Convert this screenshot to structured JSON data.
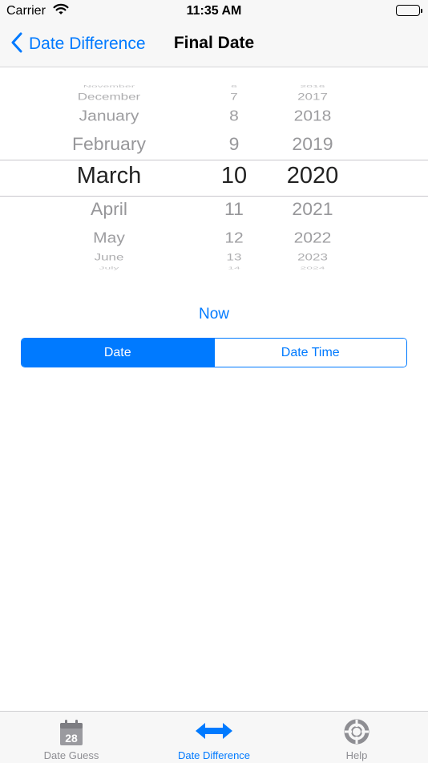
{
  "status_bar": {
    "carrier": "Carrier",
    "time": "11:35 AM"
  },
  "nav": {
    "back_label": "Date Difference",
    "title": "Final Date"
  },
  "picker": {
    "months": [
      "November",
      "December",
      "January",
      "February",
      "March",
      "April",
      "May",
      "June",
      "July"
    ],
    "days": [
      "6",
      "7",
      "8",
      "9",
      "10",
      "11",
      "12",
      "13",
      "14"
    ],
    "years": [
      "2016",
      "2017",
      "2018",
      "2019",
      "2020",
      "2021",
      "2022",
      "2023",
      "2024"
    ],
    "selected": {
      "month": "March",
      "day": "10",
      "year": "2020"
    }
  },
  "now_button": "Now",
  "segmented": {
    "options": [
      "Date",
      "Date Time"
    ],
    "selected": "Date"
  },
  "tab_bar": {
    "items": [
      {
        "label": "Date Guess",
        "icon": "calendar-icon",
        "icon_text": "28",
        "active": false
      },
      {
        "label": "Date Difference",
        "icon": "double-arrow-icon",
        "active": true
      },
      {
        "label": "Help",
        "icon": "lifebuoy-icon",
        "active": false
      }
    ]
  },
  "colors": {
    "accent": "#007aff",
    "inactive": "#8e8e93",
    "bar_background": "#f7f7f7"
  }
}
